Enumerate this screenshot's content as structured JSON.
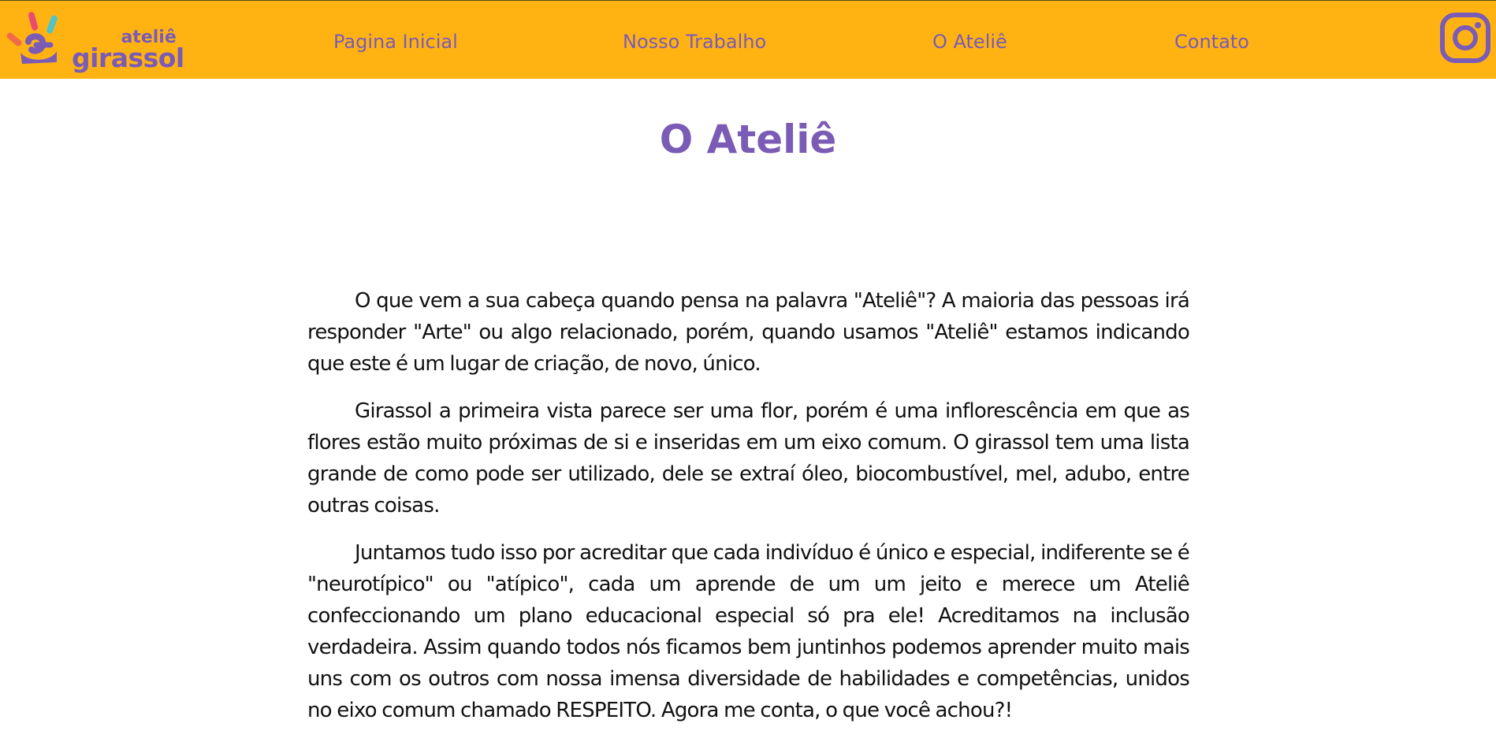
{
  "brand": {
    "line1": "ateliê",
    "line2": "girassol",
    "logo_colors": [
      "#F2694B",
      "#E84B6E",
      "#4FC3C8",
      "#7A5BB5"
    ]
  },
  "nav": {
    "items": [
      {
        "label": "Pagina Inicial"
      },
      {
        "label": "Nosso Trabalho"
      },
      {
        "label": "O Ateliê"
      },
      {
        "label": "Contato"
      }
    ],
    "social_icon": "instagram-icon"
  },
  "main": {
    "title": "O Ateliê",
    "paragraphs": [
      "O que vem a sua cabeça quando pensa na palavra \"Ateliê\"? A maioria das pessoas irá responder \"Arte\" ou algo relacionado, porém, quando usamos \"Ateliê\" estamos indicando que este é um lugar de criação, de novo, único.",
      "Girassol a primeira vista parece ser uma flor, porém é uma inflorescência em que as flores estão muito próximas de si e inseridas em um eixo comum. O girassol tem uma lista grande de como pode ser utilizado, dele se extraí óleo, biocombustível, mel, adubo, entre outras coisas.",
      "Juntamos tudo isso por acreditar que cada indivíduo é único e especial, indiferente se é \"neurotípico\" ou \"atípico\", cada um aprende de um um jeito e merece um Ateliê confeccionando um plano educacional especial só pra ele! Acreditamos na inclusão verdadeira. Assim quando todos nós ficamos bem juntinhos podemos aprender muito mais uns com os outros com nossa imensa diversidade de habilidades e competências, unidos no eixo comum chamado RESPEITO. Agora me conta, o que você achou?!"
    ]
  },
  "colors": {
    "header_bg": "#FFB313",
    "accent": "#7A5BB5",
    "text": "#111111"
  }
}
